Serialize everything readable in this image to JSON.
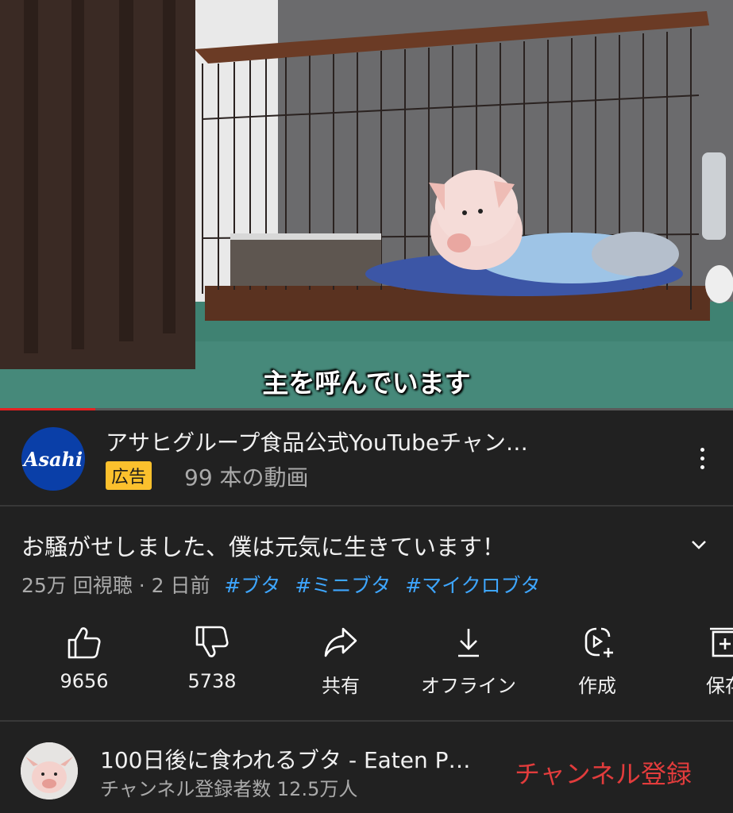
{
  "video": {
    "subtitle": "主を呼んでいます",
    "progress_fraction": 0.13
  },
  "ad": {
    "logo_text": "Asahi",
    "channel_title": "アサヒグループ食品公式YouTubeチャン…",
    "badge": "広告",
    "video_count": "99 本の動画"
  },
  "title": {
    "text": "お騒がせしました、僕は元気に生きています！",
    "views_date": "25万 回視聴 · 2 日前",
    "hashtags": [
      "#ブタ",
      "#ミニブタ",
      "#マイクロブタ"
    ]
  },
  "actions": {
    "like_count": "9656",
    "dislike_count": "5738",
    "share_label": "共有",
    "offline_label": "オフライン",
    "create_label": "作成",
    "save_label": "保存"
  },
  "channel": {
    "name": "100日後に食われるブタ - Eaten P…",
    "subscribers": "チャンネル登録者数 12.5万人",
    "subscribe_label": "チャンネル登録"
  },
  "colors": {
    "background": "#212121",
    "progress_red": "#e52222",
    "hashtag_blue": "#3ea6ff",
    "ad_badge_yellow": "#fbc02d",
    "subscribe_red": "#e23c3c",
    "asahi_blue": "#0a3fa8"
  },
  "icons": [
    "thumbs-up-icon",
    "thumbs-down-icon",
    "share-icon",
    "download-icon",
    "create-icon",
    "save-icon",
    "more-vert-icon",
    "chevron-down-icon"
  ]
}
